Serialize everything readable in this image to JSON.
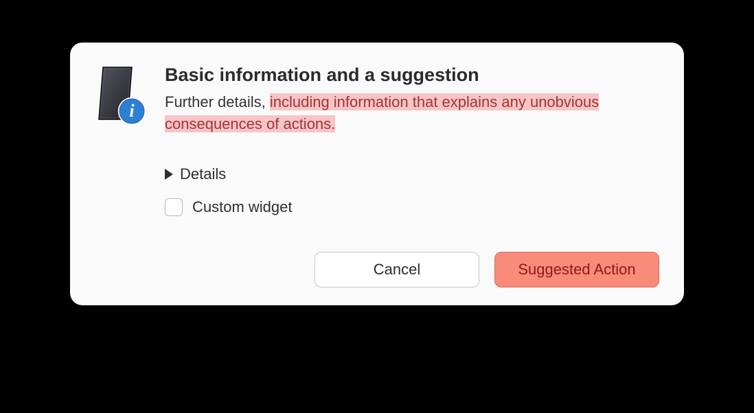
{
  "dialog": {
    "title": "Basic information and a suggestion",
    "description_plain": "Further details, ",
    "description_highlight": "including information that explains any unobvious consequences of actions.",
    "details_label": "Details",
    "checkbox_label": "Custom widget",
    "cancel_label": "Cancel",
    "suggested_label": "Suggested Action",
    "icon": {
      "phone_fill": "#3a3a44",
      "phone_edge": "#1a1a20",
      "badge_fill": "#2d7fd3",
      "badge_stroke": "#ffffff",
      "badge_letter": "i"
    },
    "colors": {
      "highlight_bg": "#f7c5c5",
      "highlight_text": "#a03538",
      "suggested_bg": "#f88b79",
      "suggested_border": "#d96a5a",
      "suggested_text": "#8f1a1a"
    }
  }
}
